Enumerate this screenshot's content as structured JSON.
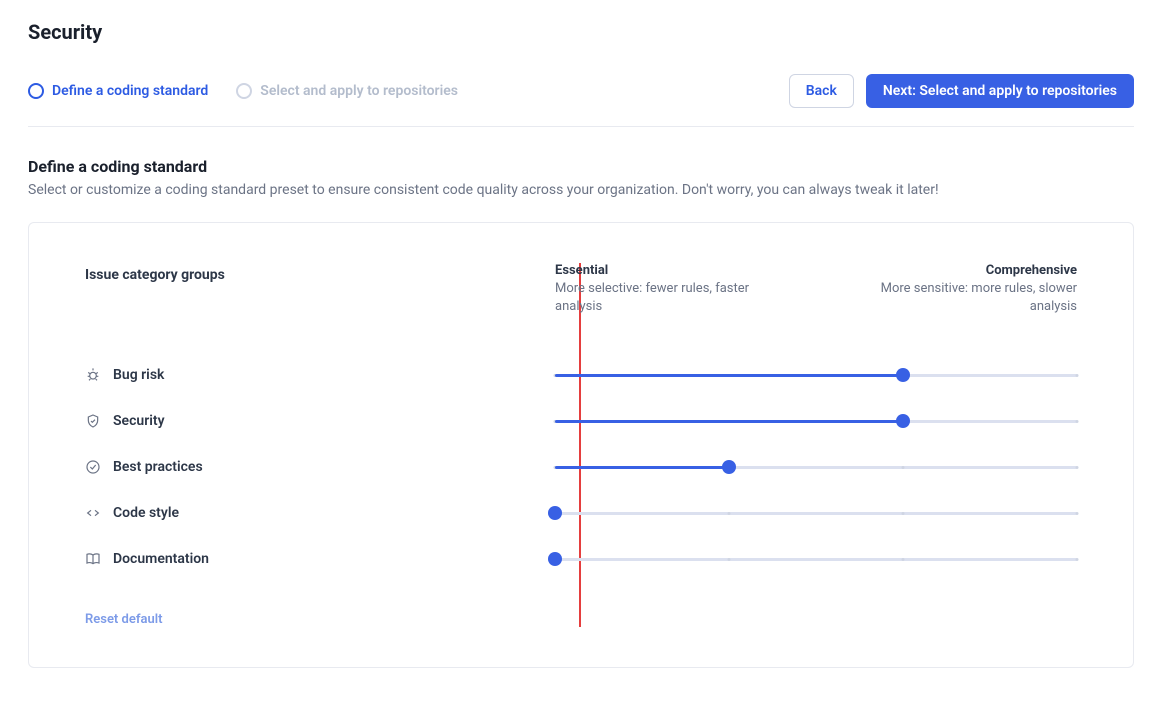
{
  "page_title": "Security",
  "stepper": {
    "step1": "Define a coding standard",
    "step2": "Select and apply to repositories"
  },
  "buttons": {
    "back": "Back",
    "next": "Next: Select and apply to repositories"
  },
  "section": {
    "title": "Define a coding standard",
    "desc": "Select or customize a coding standard preset to ensure consistent code quality across your organization. Don't worry, you can always tweak it later!"
  },
  "groups_label": "Issue category groups",
  "scale": {
    "left_title": "Essential",
    "left_desc": "More selective: fewer rules, faster analysis",
    "right_title": "Comprehensive",
    "right_desc": "More sensitive: more rules, slower analysis"
  },
  "slider_ticks": [
    0,
    33.3,
    66.6,
    100
  ],
  "categories": [
    {
      "icon": "bug",
      "label": "Bug risk",
      "value": 66.6
    },
    {
      "icon": "shield",
      "label": "Security",
      "value": 66.6
    },
    {
      "icon": "check-circle",
      "label": "Best practices",
      "value": 33.3
    },
    {
      "icon": "code",
      "label": "Code style",
      "value": 0
    },
    {
      "icon": "book",
      "label": "Documentation",
      "value": 0
    }
  ],
  "reset": "Reset default"
}
